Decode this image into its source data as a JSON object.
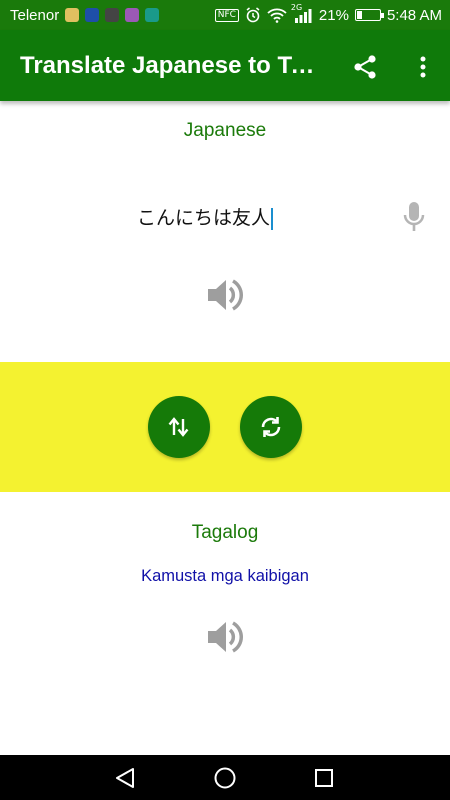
{
  "status_bar": {
    "carrier": "Telenor",
    "nfc": "NFC",
    "network": "2G",
    "battery_percent": "21%",
    "battery_level": 0.21,
    "time": "5:48 AM",
    "notification_icons": [
      "broom-icon",
      "messenger-icon",
      "clock-app-icon",
      "gallery-icon",
      "download-icon"
    ]
  },
  "app_bar": {
    "title": "Translate Japanese to Ta...",
    "share_icon": "share-icon",
    "menu_icon": "more-vert-icon"
  },
  "source": {
    "language": "Japanese",
    "text": "こんにちは友人",
    "mic_icon": "mic-icon",
    "speaker_icon": "speaker-icon"
  },
  "actions": {
    "band_color": "#f4f230",
    "button_color": "#157a08",
    "swap_icon": "swap-vertical-icon",
    "refresh_icon": "refresh-icon"
  },
  "target": {
    "language": "Tagalog",
    "text": "Kamusta mga kaibigan",
    "speaker_icon": "speaker-icon"
  },
  "colors": {
    "primary": "#0f7a0a",
    "label_green": "#1b7a0a",
    "translation_blue": "#1111a8"
  }
}
